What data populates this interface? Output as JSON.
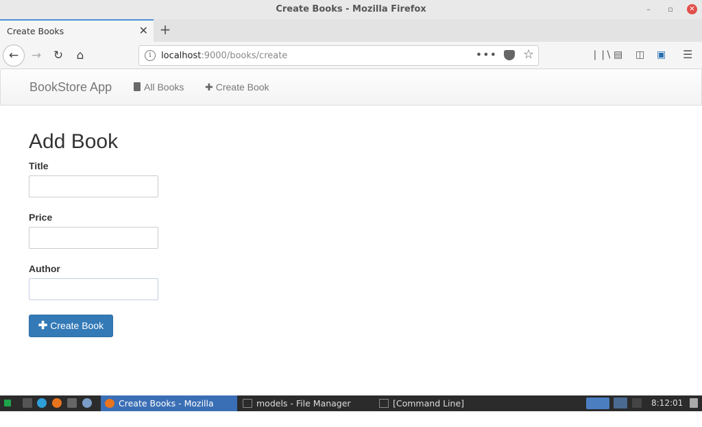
{
  "window": {
    "title": "Create Books - Mozilla Firefox"
  },
  "browser": {
    "tab_title": "Create Books",
    "url_host": "localhost",
    "url_rest": ":9000/books/create",
    "url_more": "•••"
  },
  "app": {
    "brand": "BookStore App",
    "nav": [
      {
        "label": "All Books",
        "icon": "book-icon"
      },
      {
        "label": "Create Book",
        "icon": "plus-icon"
      }
    ]
  },
  "form": {
    "heading": "Add Book",
    "fields": [
      {
        "label": "Title",
        "value": ""
      },
      {
        "label": "Price",
        "value": ""
      },
      {
        "label": "Author",
        "value": ""
      }
    ],
    "submit_label": "Create Book"
  },
  "taskbar": {
    "tasks": [
      {
        "label": "Create Books - Mozilla Firef...",
        "active": true
      },
      {
        "label": "models - File Manager",
        "active": false
      },
      {
        "label": "[Command Line]",
        "active": false
      }
    ],
    "clock": "8:12:01"
  },
  "colors": {
    "accent": "#337ab7",
    "tab_accent": "#4a90d9",
    "taskbar_active": "#3b6fb5"
  }
}
